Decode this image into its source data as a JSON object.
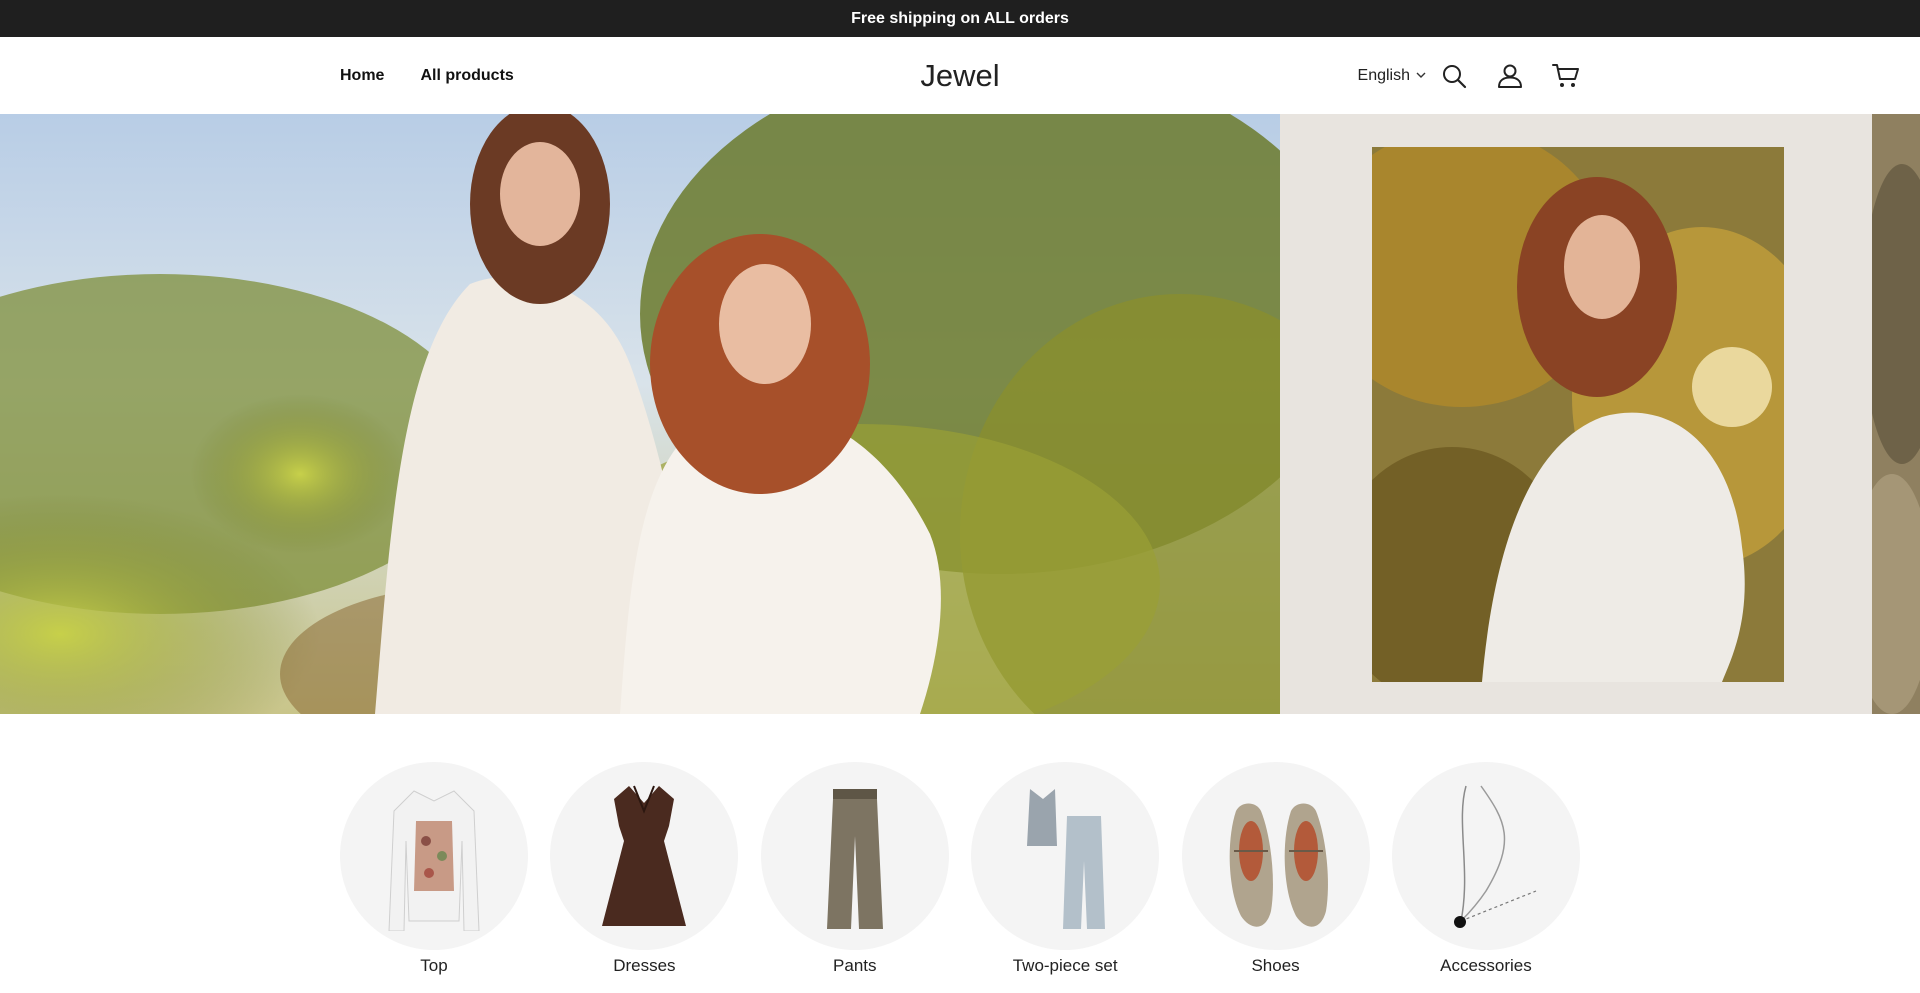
{
  "announcement": "Free shipping on ALL orders",
  "nav": {
    "home": "Home",
    "all_products": "All products"
  },
  "brand": "Jewel",
  "tools": {
    "language": "English"
  },
  "categories": [
    {
      "label": "Top"
    },
    {
      "label": "Dresses"
    },
    {
      "label": "Pants"
    },
    {
      "label": "Two-piece set"
    },
    {
      "label": "Shoes"
    },
    {
      "label": "Accessories"
    }
  ],
  "colors": {
    "announce_bg": "#1f1f1f",
    "side_panel_bg": "#e8e4df",
    "category_circle": "#f4f4f4"
  }
}
